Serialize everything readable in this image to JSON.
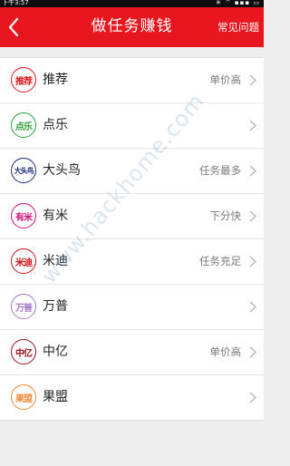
{
  "status_bar": {
    "time": "下午3:57",
    "icons": "✳ ⌔ ▪▪▪ ▭"
  },
  "header": {
    "title": "做任务赚钱",
    "action_label": "常见问题",
    "background": "#e8161e"
  },
  "items": [
    {
      "badge": "推荐",
      "name": "推荐",
      "tag": "单价高",
      "color": "#e0151d"
    },
    {
      "badge": "点乐",
      "name": "点乐",
      "tag": "",
      "color": "#2e9f3e"
    },
    {
      "badge": "大头鸟",
      "name": "大头鸟",
      "tag": "任务最多",
      "color": "#1d2a7a"
    },
    {
      "badge": "有米",
      "name": "有米",
      "tag": "下分快",
      "color": "#d4137a"
    },
    {
      "badge": "米迪",
      "name": "米迪",
      "tag": "任务充足",
      "color": "#c9141b"
    },
    {
      "badge": "万普",
      "name": "万普",
      "tag": "",
      "color": "#a77cc7"
    },
    {
      "badge": "中亿",
      "name": "中亿",
      "tag": "单价高",
      "color": "#9c1622"
    },
    {
      "badge": "果盟",
      "name": "果盟",
      "tag": "",
      "color": "#f08a3a"
    }
  ],
  "watermark": "www.hackhome.com"
}
